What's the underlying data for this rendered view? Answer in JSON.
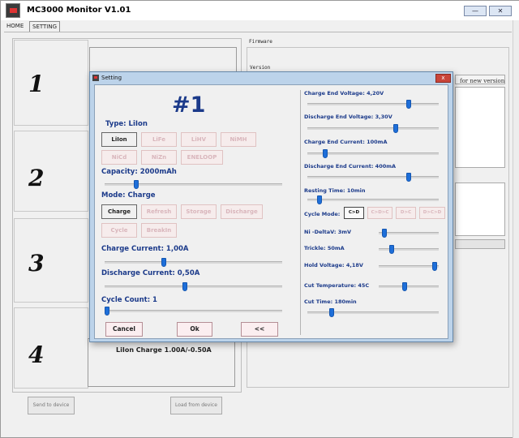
{
  "app": {
    "title": "MC3000 Monitor V1.01",
    "minimize_icon": "minimize-icon",
    "close_icon": "close-icon"
  },
  "tabs": [
    {
      "label": "HOME",
      "active": false
    },
    {
      "label": "SETTING",
      "active": true
    }
  ],
  "slots": [
    {
      "number": "1"
    },
    {
      "number": "2"
    },
    {
      "number": "3"
    },
    {
      "number": "4"
    }
  ],
  "slot4_status": "LiIon  Charge  1.00A/-0.50A",
  "firmware": {
    "label": "Firmware",
    "version_label": "Version",
    "for_new_version": "for new version"
  },
  "bottom_buttons": {
    "send": "Send to device",
    "load": "Load from device"
  },
  "dialog": {
    "title": "Setting",
    "close_label": "x",
    "slot_label": "#1",
    "type_label": "Type:  LiIon",
    "type_options": [
      "LiIon",
      "LiFe",
      "LiHV",
      "NiMH",
      "NiCd",
      "NiZn",
      "ENELOOP"
    ],
    "type_selected": "LiIon",
    "capacity_label": "Capacity:  2000mAh",
    "capacity_level": 0.17,
    "mode_label": "Mode:  Charge",
    "mode_options": [
      "Charge",
      "Refresh",
      "Storage",
      "Discharge",
      "Cycle",
      "BreakIn"
    ],
    "mode_selected": "Charge",
    "charge_current_label": "Charge Current:  1,00A",
    "charge_current_level": 0.33,
    "discharge_current_label": "Discharge Current:  0,50A",
    "discharge_current_level": 0.45,
    "cycle_count_label": "Cycle Count:  1",
    "cycle_count_level": 0.0,
    "right": {
      "charge_end_voltage": {
        "label": "Charge End Voltage:  4,20V",
        "level": 0.78
      },
      "discharge_end_voltage": {
        "label": "Discharge End Voltage:  3,30V",
        "level": 0.68
      },
      "charge_end_current": {
        "label": "Charge End Current:  100mA",
        "level": 0.12
      },
      "discharge_end_current": {
        "label": "Discharge End Current:  400mA",
        "level": 0.78
      },
      "resting_time": {
        "label": "Resting Time:  10min",
        "level": 0.08
      },
      "cycle_mode_label": "Cycle Mode:",
      "cycle_mode_options": [
        "C>D",
        "C>D>C",
        "D>C",
        "D>C>D"
      ],
      "cycle_mode_selected": "C>D",
      "ni_deltav": {
        "label": "Ni -DeltaV:  3mV",
        "level": 0.06
      },
      "trickle": {
        "label": "Trickle:  50mA",
        "level": 0.19
      },
      "hold_voltage": {
        "label": "Hold Voltage:  4,18V",
        "level": 0.97
      },
      "cut_temperature": {
        "label": "Cut Temperature:  45C",
        "level": 0.42
      },
      "cut_time": {
        "label": "Cut Time:  180min",
        "level": 0.17
      }
    },
    "buttons": {
      "cancel": "Cancel",
      "ok": "Ok",
      "back": "<<"
    }
  }
}
